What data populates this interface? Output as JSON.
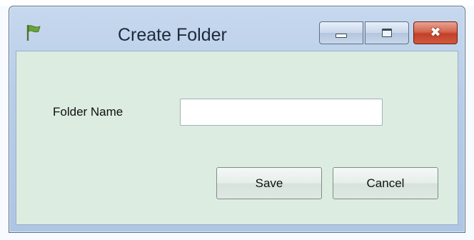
{
  "window": {
    "title": "Create Folder",
    "app_icon": "green-flag-icon"
  },
  "controls": {
    "minimize_icon": "minimize-icon",
    "maximize_icon": "maximize-icon",
    "close_icon": "close-icon",
    "close_glyph": "✖"
  },
  "form": {
    "folder_name_label": "Folder Name",
    "folder_name_value": "",
    "folder_name_placeholder": ""
  },
  "buttons": {
    "save_label": "Save",
    "cancel_label": "Cancel"
  },
  "colors": {
    "client_background": "#dcece1",
    "titlebar": "#b7cde8",
    "close_button": "#c2402a",
    "flag": "#6aa33a"
  }
}
